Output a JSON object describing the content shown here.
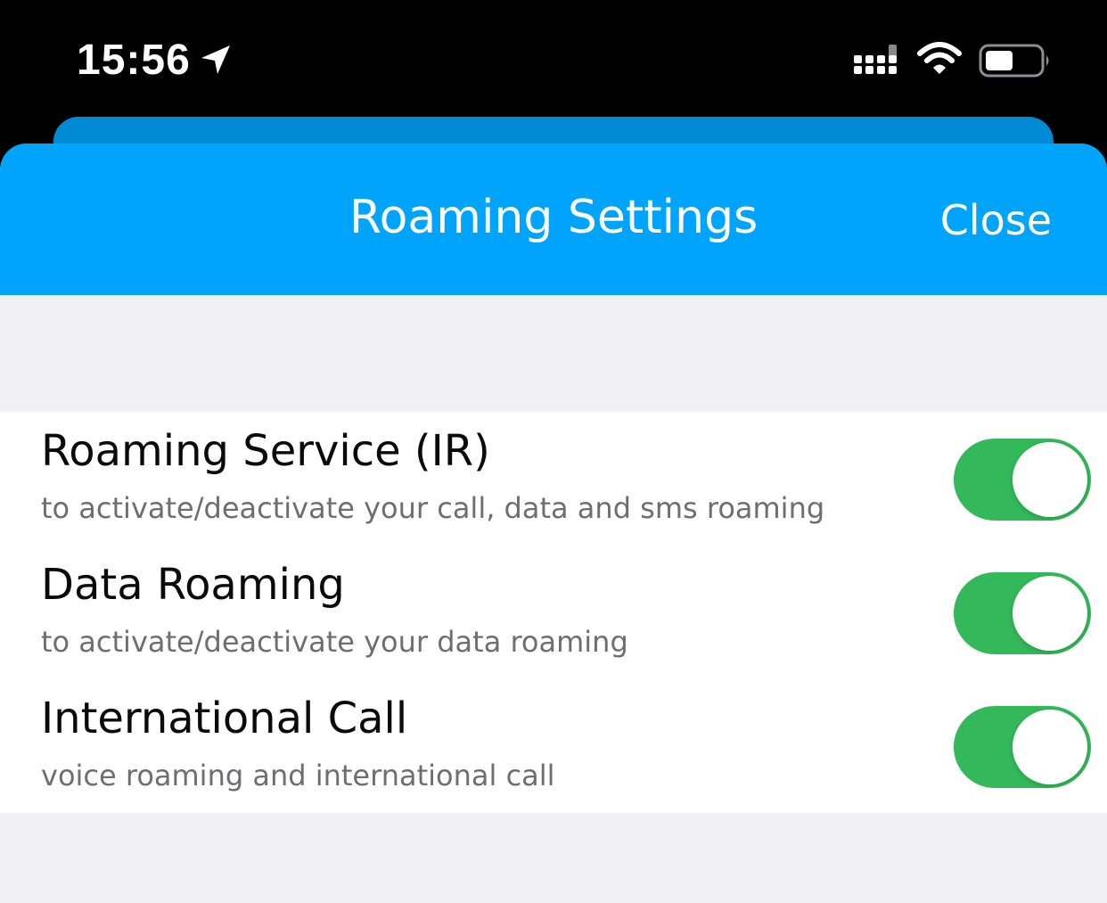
{
  "status_bar": {
    "time": "15:56",
    "icons": [
      "location-arrow-icon",
      "cellular-signal-icon",
      "wifi-icon",
      "battery-icon"
    ]
  },
  "header": {
    "title": "Roaming Settings",
    "close_label": "Close",
    "color": "#00a4fb"
  },
  "settings": [
    {
      "title": "Roaming Service (IR)",
      "subtitle": "to activate/deactivate your call, data and sms roaming",
      "enabled": true
    },
    {
      "title": "Data Roaming",
      "subtitle": "to activate/deactivate your data roaming",
      "enabled": true
    },
    {
      "title": "International Call",
      "subtitle": "voice roaming and international call",
      "enabled": true
    }
  ],
  "colors": {
    "toggle_on": "#33b85a",
    "background": "#f0f0f4",
    "subtitle_text": "#6e6e72"
  }
}
